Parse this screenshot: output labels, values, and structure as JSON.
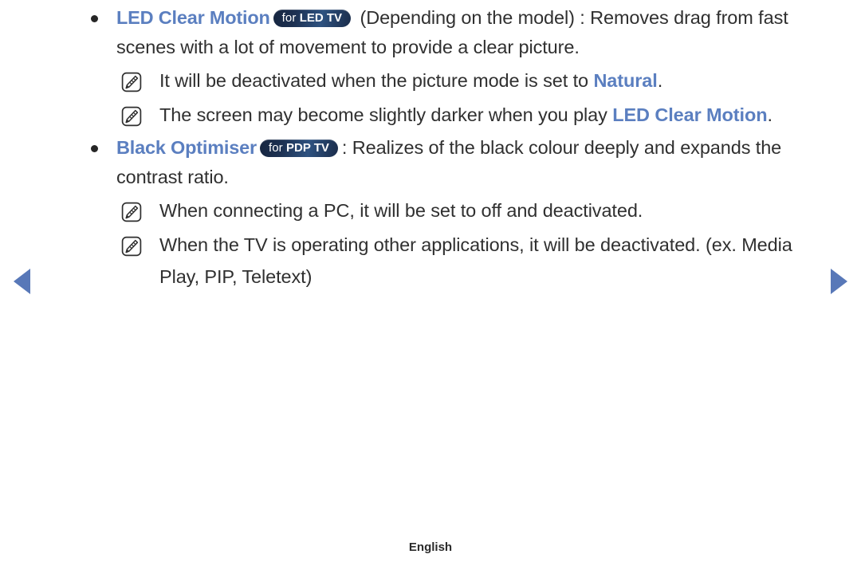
{
  "page": {
    "language_label": "English"
  },
  "nav": {
    "prev_icon": "triangle-left-icon",
    "next_icon": "triangle-right-icon",
    "arrow_color": "#5878b8"
  },
  "colors": {
    "accent_blue": "#5b7fc0",
    "badge_dark": "#16253f",
    "badge_light": "#2e5280",
    "body_text": "#303030"
  },
  "sections": [
    {
      "id": "led-clear-motion",
      "bullet_icon": "bullet-dot-icon",
      "term": "LED Clear Motion",
      "badge": {
        "prefix": "for ",
        "label": "LED TV",
        "full": "for LED TV"
      },
      "description": " (Depending on the model) : Removes drag from fast scenes with a lot of movement to provide a clear picture.",
      "notes": [
        {
          "icon": "note-pencil-icon",
          "text_before": "It will be deactivated when the picture mode is set to ",
          "highlight": "Natural",
          "text_after": "."
        },
        {
          "icon": "note-pencil-icon",
          "text_before": "The screen may become slightly darker when you play ",
          "highlight": "LED Clear Motion",
          "text_after": "."
        }
      ]
    },
    {
      "id": "black-optimiser",
      "bullet_icon": "bullet-dot-icon",
      "term": "Black Optimiser",
      "badge": {
        "prefix": "for ",
        "label": "PDP TV",
        "full": "for PDP TV"
      },
      "description": ": Realizes of the black colour deeply and expands the contrast ratio.",
      "notes": [
        {
          "icon": "note-pencil-icon",
          "text_before": "When connecting a PC, it will be set to off and deactivated.",
          "highlight": "",
          "text_after": ""
        },
        {
          "icon": "note-pencil-icon",
          "text_before": "When the TV is operating other applications, it will be deactivated. (ex. Media Play, PIP, Teletext)",
          "highlight": "",
          "text_after": ""
        }
      ]
    }
  ]
}
